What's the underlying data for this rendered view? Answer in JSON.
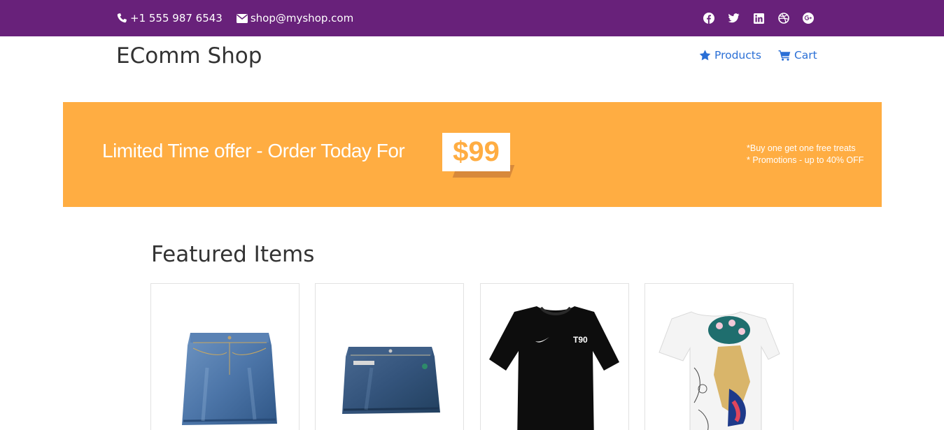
{
  "topbar": {
    "phone": "+1 555 987 6543",
    "email": "shop@myshop.com",
    "social_icons": [
      "facebook-icon",
      "twitter-icon",
      "linkedin-icon",
      "dribbble-icon",
      "google-plus-icon"
    ],
    "background_color": "#68217a"
  },
  "header": {
    "brand": "EComm Shop",
    "nav": [
      {
        "label": "Products",
        "icon": "star-icon"
      },
      {
        "label": "Cart",
        "icon": "cart-icon"
      }
    ],
    "link_color": "#2a6fd6"
  },
  "promo": {
    "headline": "Limited Time offer - Order Today For",
    "price": "$99",
    "notes": [
      "*Buy one get one free treats",
      "* Promotions - up to 40% OFF"
    ],
    "background_color": "#ffad42"
  },
  "featured": {
    "title": "Featured Items",
    "products": [
      {
        "image": "denim-skirt-light"
      },
      {
        "image": "denim-skirt-dark"
      },
      {
        "image": "black-tshirt-t90"
      },
      {
        "image": "white-printed-tshirt"
      }
    ]
  }
}
